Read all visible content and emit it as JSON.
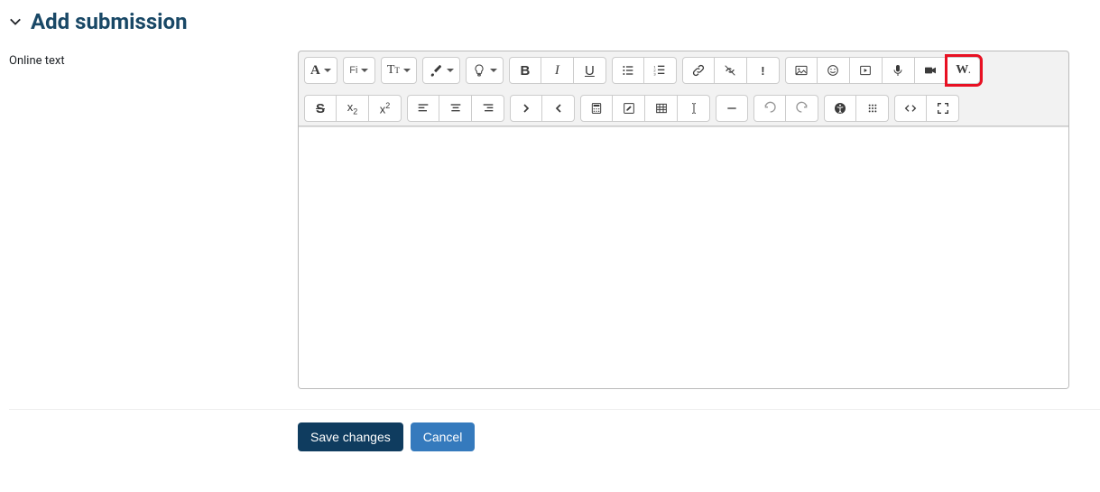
{
  "heading": "Add submission",
  "label_online_text": "Online text",
  "editor": {
    "content": ""
  },
  "actions": {
    "save": "Save changes",
    "cancel": "Cancel"
  },
  "toolbar_labels": {
    "A": "A",
    "Fi": "Fi",
    "T": "T",
    "B": "B",
    "I": "I",
    "U": "U",
    "S": "S",
    "x_sub": "x",
    "x_sup": "x",
    "exclaim": "!",
    "W": "W"
  }
}
